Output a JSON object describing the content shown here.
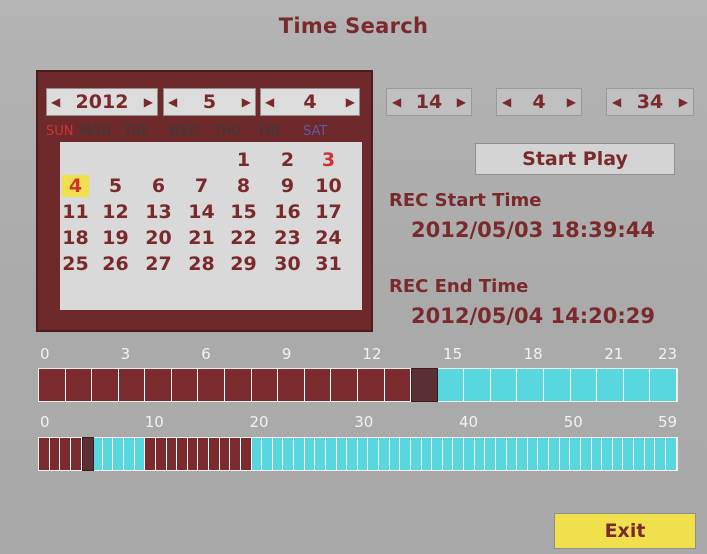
{
  "title": "Time Search",
  "date": {
    "year": "2012",
    "month": "5",
    "day": "4"
  },
  "weekdays": [
    "SUN",
    "MON",
    "TUE",
    "WED",
    "THU",
    "FRI",
    "SAT"
  ],
  "calendar": {
    "days": [
      "1",
      "2",
      "3",
      "4",
      "5",
      "6",
      "7",
      "8",
      "9",
      "10",
      "11",
      "12",
      "13",
      "14",
      "15",
      "16",
      "17",
      "18",
      "19",
      "20",
      "21",
      "22",
      "23",
      "24",
      "25",
      "26",
      "27",
      "28",
      "29",
      "30",
      "31"
    ],
    "first_weekday_index": 2,
    "highlight_day": "4",
    "red_days": [
      "3"
    ]
  },
  "time": {
    "hour": "14",
    "minute": "4",
    "second": "34"
  },
  "buttons": {
    "start_play": "Start Play",
    "exit": "Exit"
  },
  "rec_start": {
    "label": "REC Start Time",
    "value": "2012/05/03 18:39:44"
  },
  "rec_end": {
    "label": "REC End Time",
    "value": "2012/05/04 14:20:29"
  },
  "hour_bar": {
    "tick_labels": [
      "0",
      "3",
      "6",
      "9",
      "12",
      "15",
      "18",
      "21",
      "23"
    ],
    "cells": 24,
    "recorded_hours": 15,
    "selected_hour": 14
  },
  "minute_bar": {
    "tick_labels": [
      "0",
      "10",
      "20",
      "30",
      "40",
      "50",
      "59"
    ],
    "cells": 60,
    "recorded_minute_ranges": [
      [
        0,
        4
      ],
      [
        10,
        20
      ]
    ],
    "selected_minute": 4
  },
  "colors": {
    "recorded": "#7b2a2d",
    "not_recorded": "#58d7de",
    "highlight": "#efe04c",
    "accent": "#7a2a2c"
  }
}
